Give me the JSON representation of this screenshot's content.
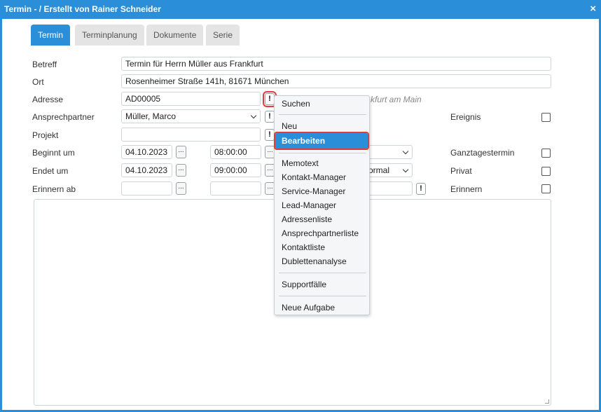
{
  "window": {
    "title": "Termin - / Erstellt von Rainer Schneider",
    "close_symbol": "×"
  },
  "tabs": [
    {
      "label": "Termin",
      "active": true
    },
    {
      "label": "Terminplanung",
      "active": false
    },
    {
      "label": "Dokumente",
      "active": false
    },
    {
      "label": "Serie",
      "active": false
    }
  ],
  "form": {
    "betreff": {
      "label": "Betreff",
      "value": "Termin für Herrn Müller aus Frankfurt"
    },
    "ort": {
      "label": "Ort",
      "value": "Rosenheimer Straße 141h, 81671 München"
    },
    "adresse": {
      "label": "Adresse",
      "value": "AD00005",
      "hint": "kfurt am Main"
    },
    "ansprechpartner": {
      "label": "Ansprechpartner",
      "value": "Müller, Marco"
    },
    "projekt": {
      "label": "Projekt",
      "value": ""
    },
    "beginnt": {
      "label": "Beginnt um",
      "date": "04.10.2023",
      "time": "08:00:00"
    },
    "endet": {
      "label": "Endet um",
      "date": "04.10.2023",
      "time": "09:00:00",
      "priority_partial": "ormal"
    },
    "erinnern_ab": {
      "label": "Erinnern ab",
      "date": "",
      "time": ""
    }
  },
  "checkboxes": {
    "ereignis": {
      "label": "Ereignis",
      "checked": false
    },
    "ganztagestermin": {
      "label": "Ganztagestermin",
      "checked": false
    },
    "privat": {
      "label": "Privat",
      "checked": false
    },
    "erinnern": {
      "label": "Erinnern",
      "checked": false
    }
  },
  "buttons": {
    "dots": "...",
    "excl": "!"
  },
  "context_menu": {
    "groups": [
      [
        "Suchen"
      ],
      [
        "Neu",
        "Bearbeiten"
      ],
      [
        "Memotext",
        "Kontakt-Manager",
        "Service-Manager",
        "Lead-Manager",
        "Adressenliste",
        "Ansprechpartnerliste",
        "Kontaktliste",
        "Dublettenanalyse"
      ],
      [
        "Supportfälle"
      ],
      [
        "Neue Aufgabe"
      ]
    ],
    "selected": "Bearbeiten"
  },
  "colors": {
    "accent": "#2a8fd8",
    "highlight_outline": "#e23b3b"
  }
}
